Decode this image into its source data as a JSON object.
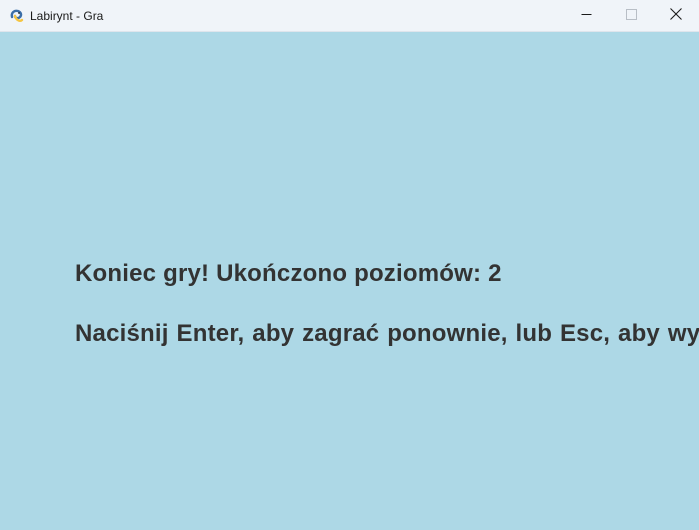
{
  "window": {
    "title": "Labirynt - Gra",
    "icon": "pygame-snake-icon",
    "controls": {
      "minimize": "minimize-icon",
      "maximize": "maximize-icon",
      "close": "close-icon"
    }
  },
  "game": {
    "background_color": "#add8e6",
    "text_color": "#333333",
    "game_over_line": "Koniec gry! Ukończono poziomów: 2",
    "instructions_line": "Naciśnij Enter, aby zagrać ponownie,  lub Esc, aby wyjść."
  }
}
